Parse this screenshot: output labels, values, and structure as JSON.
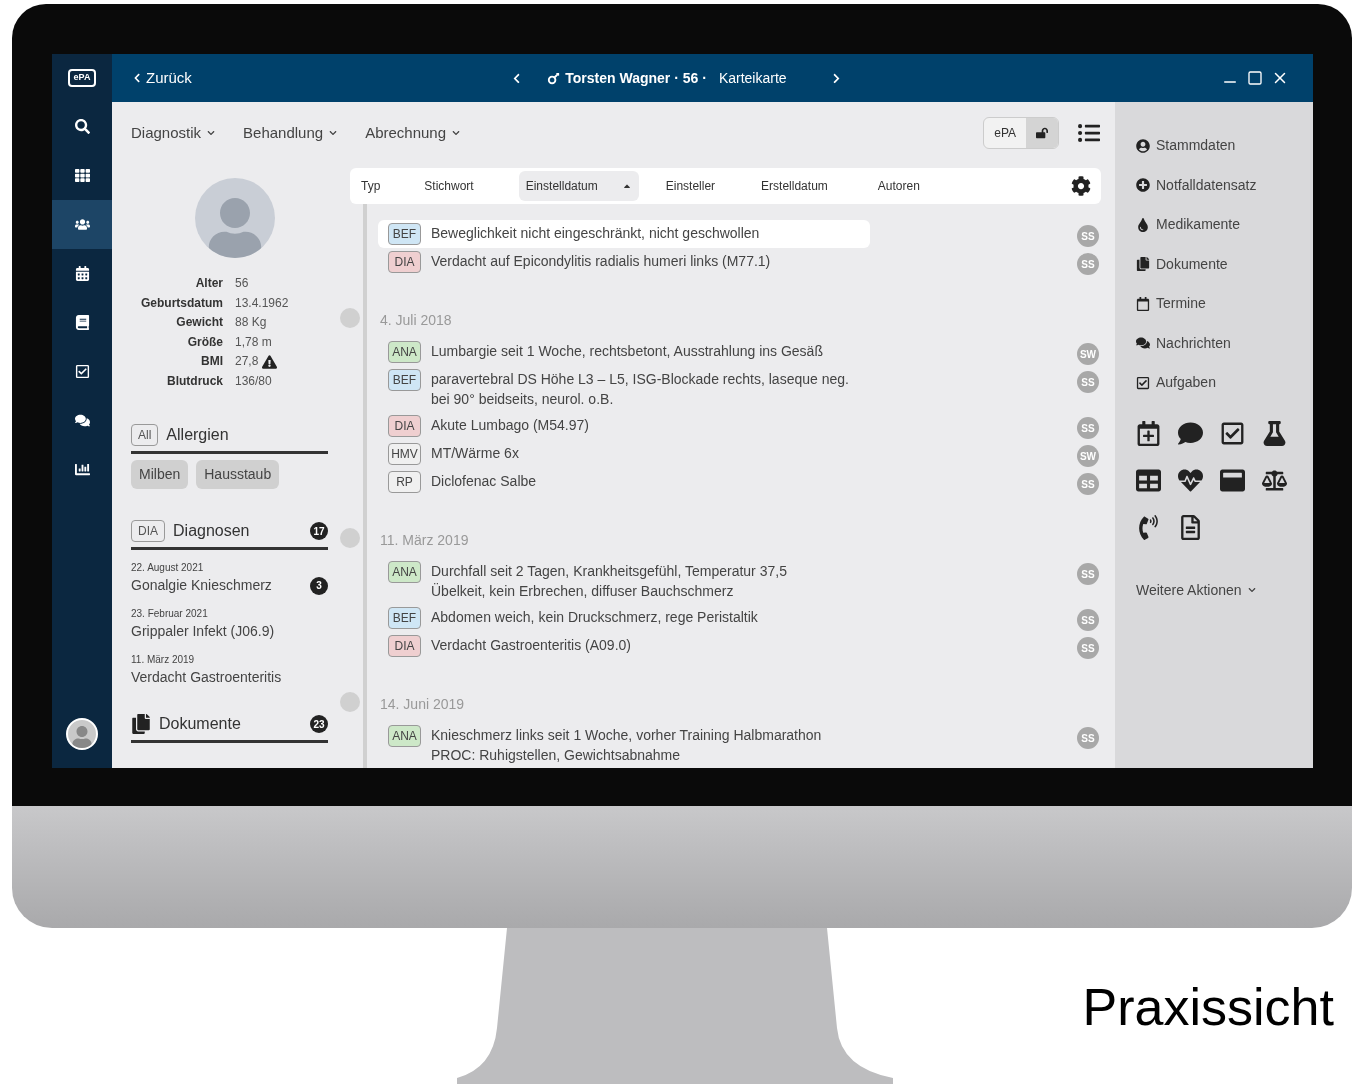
{
  "window": {
    "logo": "ePA",
    "back": "Zurück",
    "patient_name": "Torsten Wagner",
    "age": "56",
    "view": "Karteikarte",
    "separator": "·"
  },
  "rail": [
    {
      "selected": false
    },
    {
      "selected": false
    },
    {
      "selected": true
    },
    {
      "selected": false
    },
    {
      "selected": false
    },
    {
      "selected": false
    },
    {
      "selected": false
    },
    {
      "selected": false
    }
  ],
  "menus": [
    "Diagnostik",
    "Behandlung",
    "Abrechnung"
  ],
  "epa_toggle": {
    "label": "ePA"
  },
  "patient": {
    "facts": [
      {
        "label": "Alter",
        "value": "56",
        "warning": false
      },
      {
        "label": "Geburtsdatum",
        "value": "13.4.1962",
        "warning": false
      },
      {
        "label": "Gewicht",
        "value": "88 Kg",
        "warning": false
      },
      {
        "label": "Größe",
        "value": "1,78 m",
        "warning": false
      },
      {
        "label": "BMI",
        "value": "27,8",
        "warning": true
      },
      {
        "label": "Blutdruck",
        "value": "136/80",
        "warning": false
      }
    ]
  },
  "allergies": {
    "tag": "All",
    "title": "Allergien",
    "items": [
      "Milben",
      "Hausstaub"
    ]
  },
  "diagnoses": {
    "tag": "DIA",
    "title": "Diagnosen",
    "count": "17",
    "items": [
      {
        "date": "22. August 2021",
        "name": "Gonalgie Knieschmerz",
        "count": "3"
      },
      {
        "date": "23. Februar 2021",
        "name": "Grippaler Infekt (J06.9)"
      },
      {
        "date": "11. März 2019",
        "name": "Verdacht Gastroenteritis"
      }
    ]
  },
  "documents": {
    "title": "Dokumente",
    "count": "23"
  },
  "columns": [
    {
      "label": "Typ",
      "selected": false
    },
    {
      "label": "Stichwort",
      "selected": false
    },
    {
      "label": "Einstelldatum",
      "selected": true
    },
    {
      "label": "Einsteller",
      "selected": false
    },
    {
      "label": "Erstelldatum",
      "selected": false
    },
    {
      "label": "Autoren",
      "selected": false
    }
  ],
  "timeline": [
    {
      "entries": [
        {
          "type": "BEF",
          "color": "#cfe6f5",
          "text": "Beweglichkeit nicht eingeschränkt, nicht geschwollen",
          "author": "SS",
          "selected": true
        },
        {
          "type": "DIA",
          "color": "#efcfd0",
          "text": "Verdacht auf Epicondylitis radialis humeri links (M77.1)",
          "author": "SS",
          "selected": false
        }
      ]
    },
    {
      "date": "4. Juli 2018",
      "entries": [
        {
          "type": "ANA",
          "color": "#cde8c8",
          "text": "Lumbargie seit 1 Woche, rechtsbetont, Ausstrahlung ins Gesäß",
          "author": "SW",
          "selected": false
        },
        {
          "type": "BEF",
          "color": "#cfe6f5",
          "text": "paravertebral DS Höhe L3 – L5, ISG-Blockade rechts, laseque neg.",
          "text2": "bei 90° beidseits, neurol. o.B.",
          "author": "SS",
          "selected": false
        },
        {
          "type": "DIA",
          "color": "#efcfd0",
          "text": "Akute Lumbago (M54.97)",
          "author": "SS",
          "selected": false
        },
        {
          "type": "HMV",
          "color": "#f0f0f0",
          "text": "MT/Wärme 6x",
          "author": "SW",
          "selected": false
        },
        {
          "type": "RP",
          "color": "#f0f0f0",
          "text": "Diclofenac Salbe",
          "author": "SS",
          "selected": false
        }
      ]
    },
    {
      "date": "11. März 2019",
      "entries": [
        {
          "type": "ANA",
          "color": "#cde8c8",
          "text": "Durchfall seit 2 Tagen, Krankheitsgefühl, Temperatur 37,5",
          "text2": "Übelkeit, kein Erbrechen, diffuser Bauchschmerz",
          "author": "SS",
          "selected": false
        },
        {
          "type": "BEF",
          "color": "#cfe6f5",
          "text": "Abdomen weich, kein Druckschmerz, rege Peristaltik",
          "author": "SS",
          "selected": false
        },
        {
          "type": "DIA",
          "color": "#efcfd0",
          "text": "Verdacht Gastroenteritis (A09.0)",
          "author": "SS",
          "selected": false
        }
      ]
    },
    {
      "date": "14. Juni 2019",
      "entries": [
        {
          "type": "ANA",
          "color": "#cde8c8",
          "text": "Knieschmerz links seit 1 Woche, vorher Training Halbmarathon",
          "text2": "PROC: Ruhigstellen, Gewichtsabnahme",
          "author": "SS",
          "selected": false
        }
      ]
    }
  ],
  "side_links": [
    "Stammdaten",
    "Notfalldatensatz",
    "Medikamente",
    "Dokumente",
    "Termine",
    "Nachrichten",
    "Aufgaben"
  ],
  "more_actions": "Weitere Aktionen",
  "caption": "Praxissicht"
}
